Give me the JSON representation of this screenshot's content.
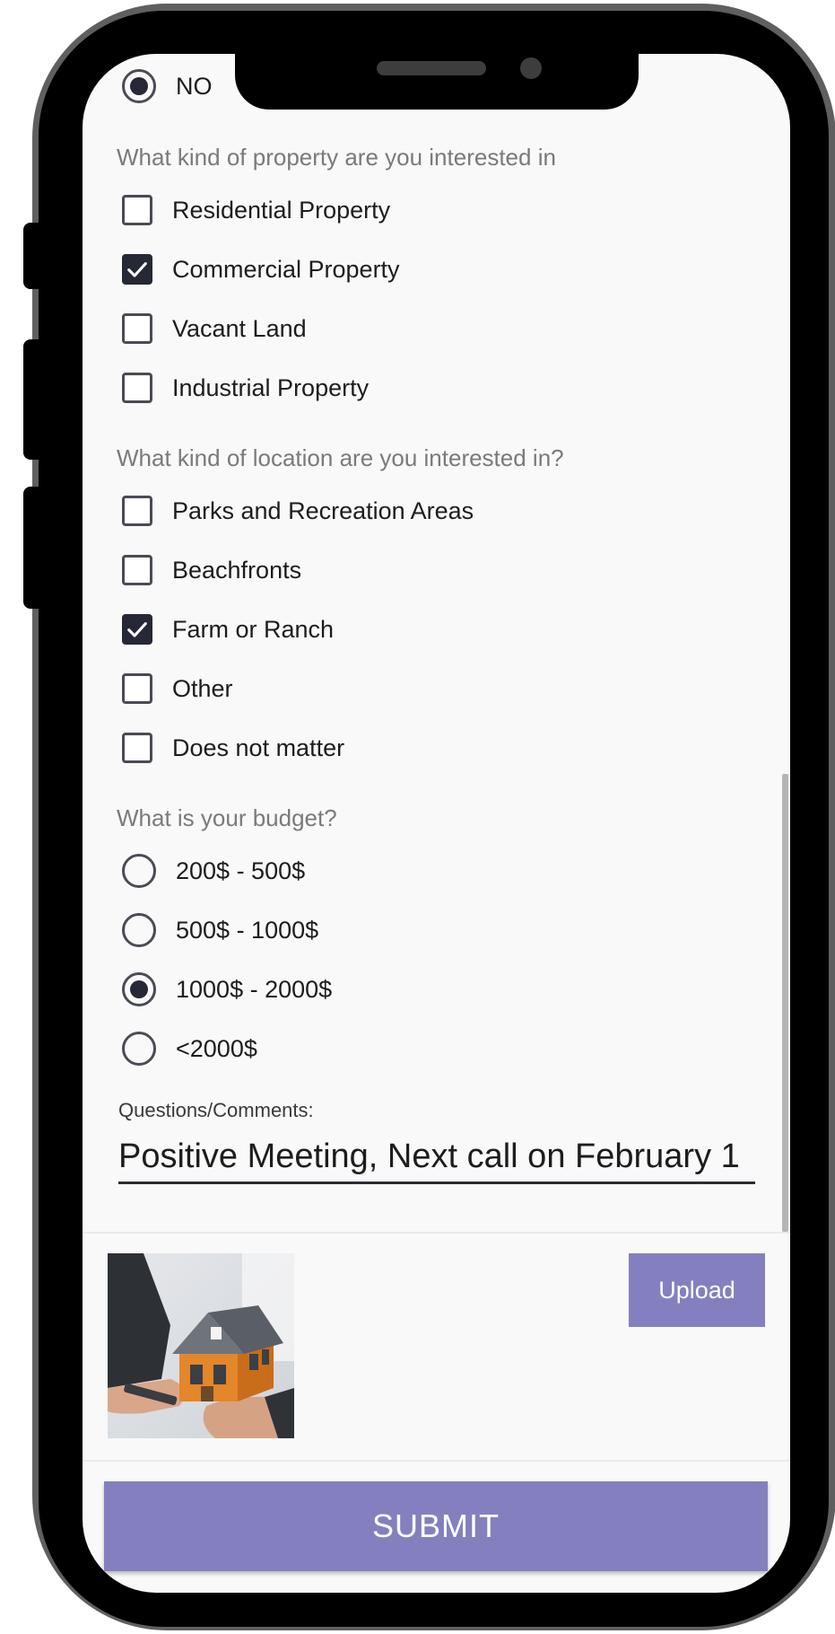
{
  "form": {
    "prev_radio": {
      "label": "NO",
      "selected": true
    },
    "property_question": "What kind of property are you interested in",
    "property_options": [
      {
        "label": "Residential Property",
        "checked": false
      },
      {
        "label": "Commercial Property",
        "checked": true
      },
      {
        "label": "Vacant Land",
        "checked": false
      },
      {
        "label": "Industrial Property",
        "checked": false
      }
    ],
    "location_question": "What kind of location are you interested in?",
    "location_options": [
      {
        "label": "Parks and Recreation Areas",
        "checked": false
      },
      {
        "label": "Beachfronts",
        "checked": false
      },
      {
        "label": "Farm or Ranch",
        "checked": true
      },
      {
        "label": "Other",
        "checked": false
      },
      {
        "label": "Does not matter",
        "checked": false
      }
    ],
    "budget_question": "What is your budget?",
    "budget_options": [
      {
        "label": "200$ - 500$",
        "selected": false
      },
      {
        "label": "500$ - 1000$",
        "selected": false
      },
      {
        "label": "1000$ - 2000$",
        "selected": true
      },
      {
        "label": "<2000$",
        "selected": false
      }
    ],
    "comments_label": "Questions/Comments:",
    "comments_value": "Positive Meeting, Next call on February 1",
    "upload_label": "Upload",
    "submit_label": "SUBMIT"
  },
  "colors": {
    "accent": "#8480bf",
    "checked_fill": "#272836",
    "question_text": "#7a7a7a"
  }
}
